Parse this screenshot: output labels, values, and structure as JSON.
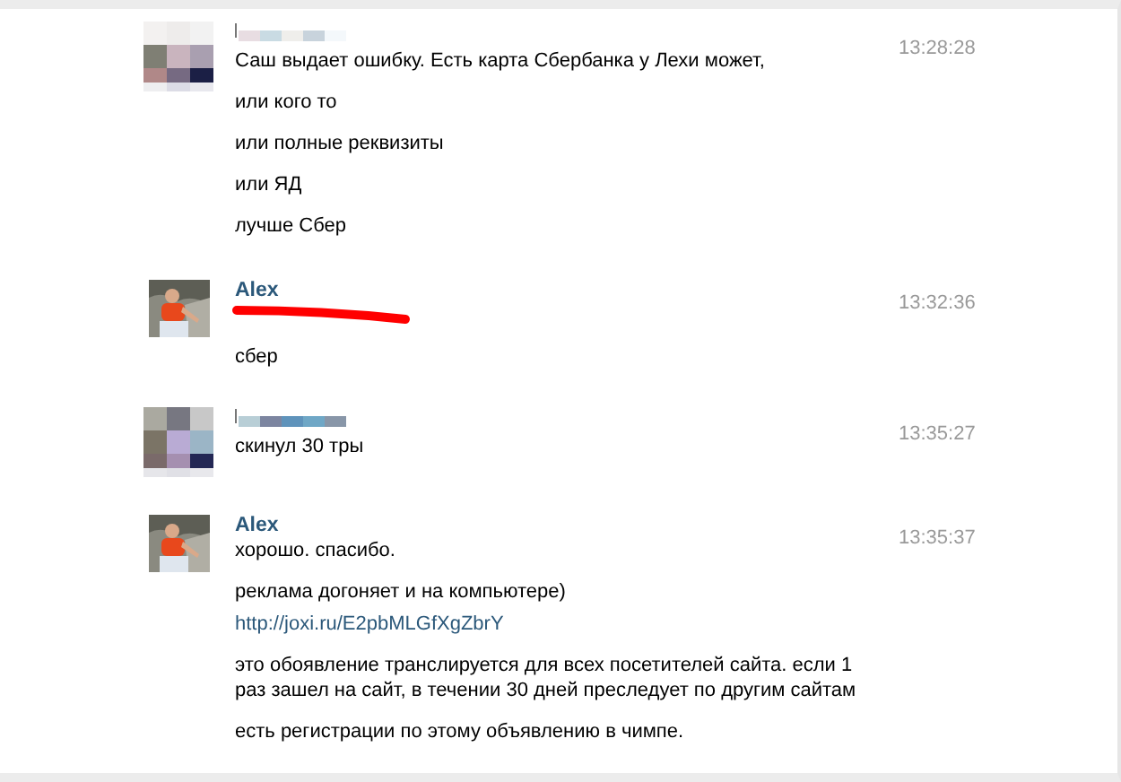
{
  "messages": [
    {
      "author": {
        "kind": "redacted"
      },
      "avatar": {
        "kind": "pixelated"
      },
      "time": "13:28:28",
      "lines": [
        {
          "kind": "text",
          "text": "Саш выдает ошибку. Есть карта Сбербанка у Лехи может,"
        },
        {
          "kind": "text",
          "text": "или кого то"
        },
        {
          "kind": "text",
          "text": "или полные реквизиты"
        },
        {
          "kind": "text",
          "text": "или ЯД"
        },
        {
          "kind": "text",
          "text": "лучше Сбер"
        }
      ]
    },
    {
      "author": {
        "kind": "name",
        "name": "Alex"
      },
      "avatar": {
        "kind": "picture"
      },
      "time": "13:32:36",
      "lines": [
        {
          "kind": "redacted"
        },
        {
          "kind": "text",
          "text": "сбер"
        }
      ]
    },
    {
      "author": {
        "kind": "redacted"
      },
      "avatar": {
        "kind": "pixelated"
      },
      "time": "13:35:27",
      "lines": [
        {
          "kind": "text",
          "text": "скинул 30 тры"
        }
      ]
    },
    {
      "author": {
        "kind": "name",
        "name": "Alex"
      },
      "avatar": {
        "kind": "picture"
      },
      "time": "13:35:37",
      "lines": [
        {
          "kind": "text",
          "text": "хорошо. спасибо."
        },
        {
          "kind": "text",
          "text": "реклама догоняет и на компьютере)",
          "link": "http://joxi.ru/E2pbMLGfXgZbrY"
        },
        {
          "kind": "text",
          "text": "это обоявление транслируется для всех посетителей сайта. если 1 раз зашел на сайт, в течении 30 дней преследует по другим сайтам"
        },
        {
          "kind": "text",
          "text": "есть регистрации по этому объявлению в чимпе."
        }
      ]
    }
  ]
}
